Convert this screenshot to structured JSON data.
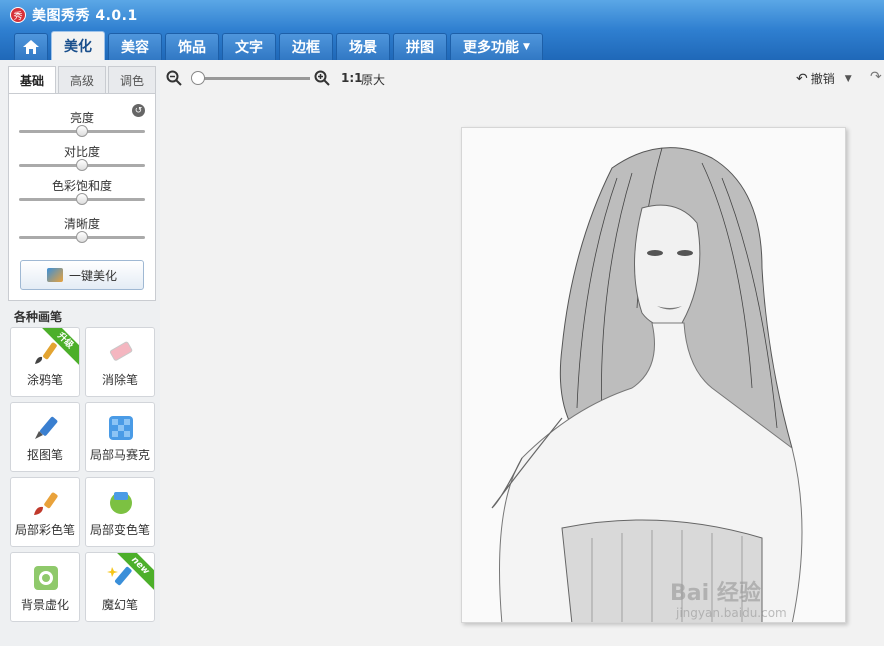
{
  "window": {
    "title": "美图秀秀 4.0.1",
    "logo_char": "秀"
  },
  "tabs": [
    {
      "id": "home",
      "label": ""
    },
    {
      "id": "beautify",
      "label": "美化",
      "active": true
    },
    {
      "id": "makeup",
      "label": "美容"
    },
    {
      "id": "accessories",
      "label": "饰品"
    },
    {
      "id": "text",
      "label": "文字"
    },
    {
      "id": "frame",
      "label": "边框"
    },
    {
      "id": "scene",
      "label": "场景"
    },
    {
      "id": "collage",
      "label": "拼图"
    },
    {
      "id": "more",
      "label": "更多功能"
    }
  ],
  "sub_tabs": [
    "基础",
    "高级",
    "调色"
  ],
  "sliders": [
    {
      "label": "亮度",
      "value": 0.5
    },
    {
      "label": "对比度",
      "value": 0.5
    },
    {
      "label": "色彩饱和度",
      "value": 0.5
    },
    {
      "label": "清晰度",
      "value": 0.5
    }
  ],
  "one_click_label": "一键美化",
  "brushes_title": "各种画笔",
  "brushes": [
    {
      "label": "涂鸦笔",
      "badge": "升级",
      "icon": "paintbrush-icon"
    },
    {
      "label": "消除笔",
      "badge": "",
      "icon": "eraser-icon"
    },
    {
      "label": "抠图笔",
      "badge": "",
      "icon": "cutout-pen-icon"
    },
    {
      "label": "局部马赛克",
      "badge": "",
      "icon": "mosaic-icon"
    },
    {
      "label": "局部彩色笔",
      "badge": "",
      "icon": "color-brush-icon"
    },
    {
      "label": "局部变色笔",
      "badge": "",
      "icon": "color-change-icon"
    },
    {
      "label": "背景虚化",
      "badge": "",
      "icon": "blur-icon"
    },
    {
      "label": "魔幻笔",
      "badge": "new",
      "icon": "magic-pen-icon"
    }
  ],
  "toolbar": {
    "zoom_value": 0.05,
    "ratio_label": "1:1",
    "orig_label": "原大",
    "undo_label": "撤销"
  },
  "watermark": {
    "main": "Bai 经验",
    "sub": "jingyan.baidu.com"
  },
  "colors": {
    "titlebar": "#2f7fd0",
    "active_tab_text": "#1a4f8c",
    "ribbon": "#4caf2a"
  }
}
